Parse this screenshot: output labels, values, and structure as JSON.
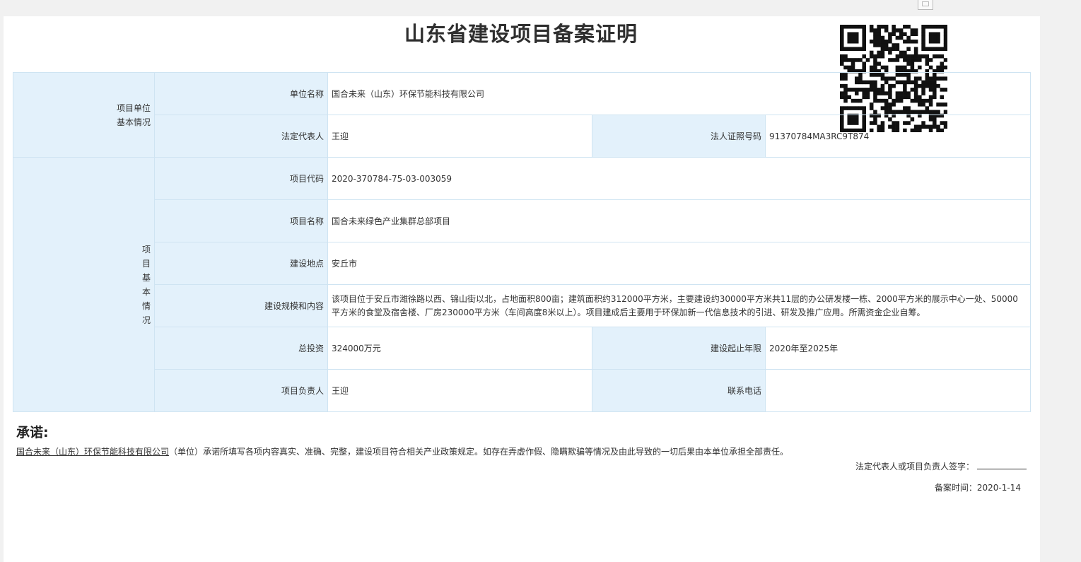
{
  "document": {
    "title": "山东省建设项目备案证明"
  },
  "unit_section": {
    "group_label_line1": "项目单位",
    "group_label_line2": "基本情况",
    "company_label": "单位名称",
    "company_value": "国合未来（山东）环保节能科技有限公司",
    "legal_rep_label": "法定代表人",
    "legal_rep_value": "王迎",
    "license_label": "法人证照号码",
    "license_value": "91370784MA3RC9T874"
  },
  "project_section": {
    "group_chars": [
      "项",
      "目",
      "基",
      "本",
      "情",
      "况"
    ],
    "code_label": "项目代码",
    "code_value": "2020-370784-75-03-003059",
    "name_label": "项目名称",
    "name_value": "国合未来绿色产业集群总部项目",
    "location_label": "建设地点",
    "location_value": "安丘市",
    "scale_label": "建设规模和内容",
    "scale_value": "该项目位于安丘市潍徐路以西、锦山街以北，占地面积800亩；建筑面积约312000平方米，主要建设约30000平方米共11层的办公研发楼一栋、2000平方米的展示中心一处、50000平方米的食堂及宿舍楼、厂房230000平方米（车间高度8米以上）。项目建成后主要用于环保加新一代信息技术的引进、研发及推广应用。所需资金企业自筹。",
    "investment_label": "总投资",
    "investment_value": "324000万元",
    "period_label": "建设起止年限",
    "period_value": "2020年至2025年",
    "manager_label": "项目负责人",
    "manager_value": "王迎",
    "phone_label": "联系电话",
    "phone_value": ""
  },
  "promise": {
    "title": "承诺:",
    "company": "国合未来（山东）环保节能科技有限公司",
    "text": "（单位）承诺所填写各项内容真实、准确、完整，建设项目符合相关产业政策规定。如存在弄虚作假、隐瞒欺骗等情况及由此导致的一切后果由本单位承担全部责任。",
    "signature_label": "法定代表人或项目负责人签字：",
    "filing_date_label": "备案时间：",
    "filing_date_value": "2020-1-14"
  }
}
